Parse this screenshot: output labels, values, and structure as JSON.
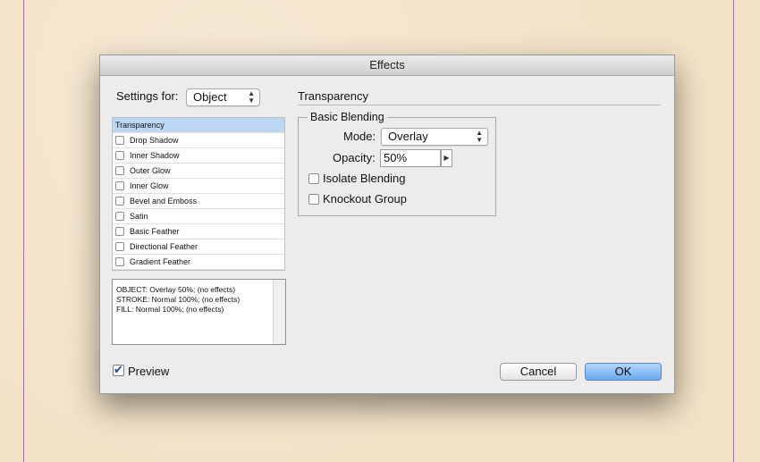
{
  "window": {
    "title": "Effects"
  },
  "settings": {
    "label": "Settings for:",
    "selected": "Object"
  },
  "effects": [
    {
      "label": "Transparency",
      "has_checkbox": false,
      "selected": true
    },
    {
      "label": "Drop Shadow",
      "has_checkbox": true,
      "checked": false
    },
    {
      "label": "Inner Shadow",
      "has_checkbox": true,
      "checked": false
    },
    {
      "label": "Outer Glow",
      "has_checkbox": true,
      "checked": false
    },
    {
      "label": "Inner Glow",
      "has_checkbox": true,
      "checked": false
    },
    {
      "label": "Bevel and Emboss",
      "has_checkbox": true,
      "checked": false
    },
    {
      "label": "Satin",
      "has_checkbox": true,
      "checked": false
    },
    {
      "label": "Basic Feather",
      "has_checkbox": true,
      "checked": false
    },
    {
      "label": "Directional Feather",
      "has_checkbox": true,
      "checked": false
    },
    {
      "label": "Gradient Feather",
      "has_checkbox": true,
      "checked": false
    }
  ],
  "summary": [
    "OBJECT: Overlay 50%; (no effects)",
    "STROKE: Normal 100%; (no effects)",
    "FILL: Normal 100%; (no effects)"
  ],
  "panel": {
    "title": "Transparency",
    "basic_blending": {
      "title": "Basic Blending",
      "mode_label": "Mode:",
      "mode_value": "Overlay",
      "opacity_label": "Opacity:",
      "opacity_value": "50%",
      "isolate_label": "Isolate Blending",
      "knockout_label": "Knockout Group"
    }
  },
  "footer": {
    "preview_label": "Preview",
    "preview_checked": true,
    "cancel_label": "Cancel",
    "ok_label": "OK"
  },
  "colors": {
    "selection": "#bcd7f3",
    "primary_button": "#6aa8ef",
    "guide_line": "#b25bc9",
    "background": "#f3e2c6"
  }
}
